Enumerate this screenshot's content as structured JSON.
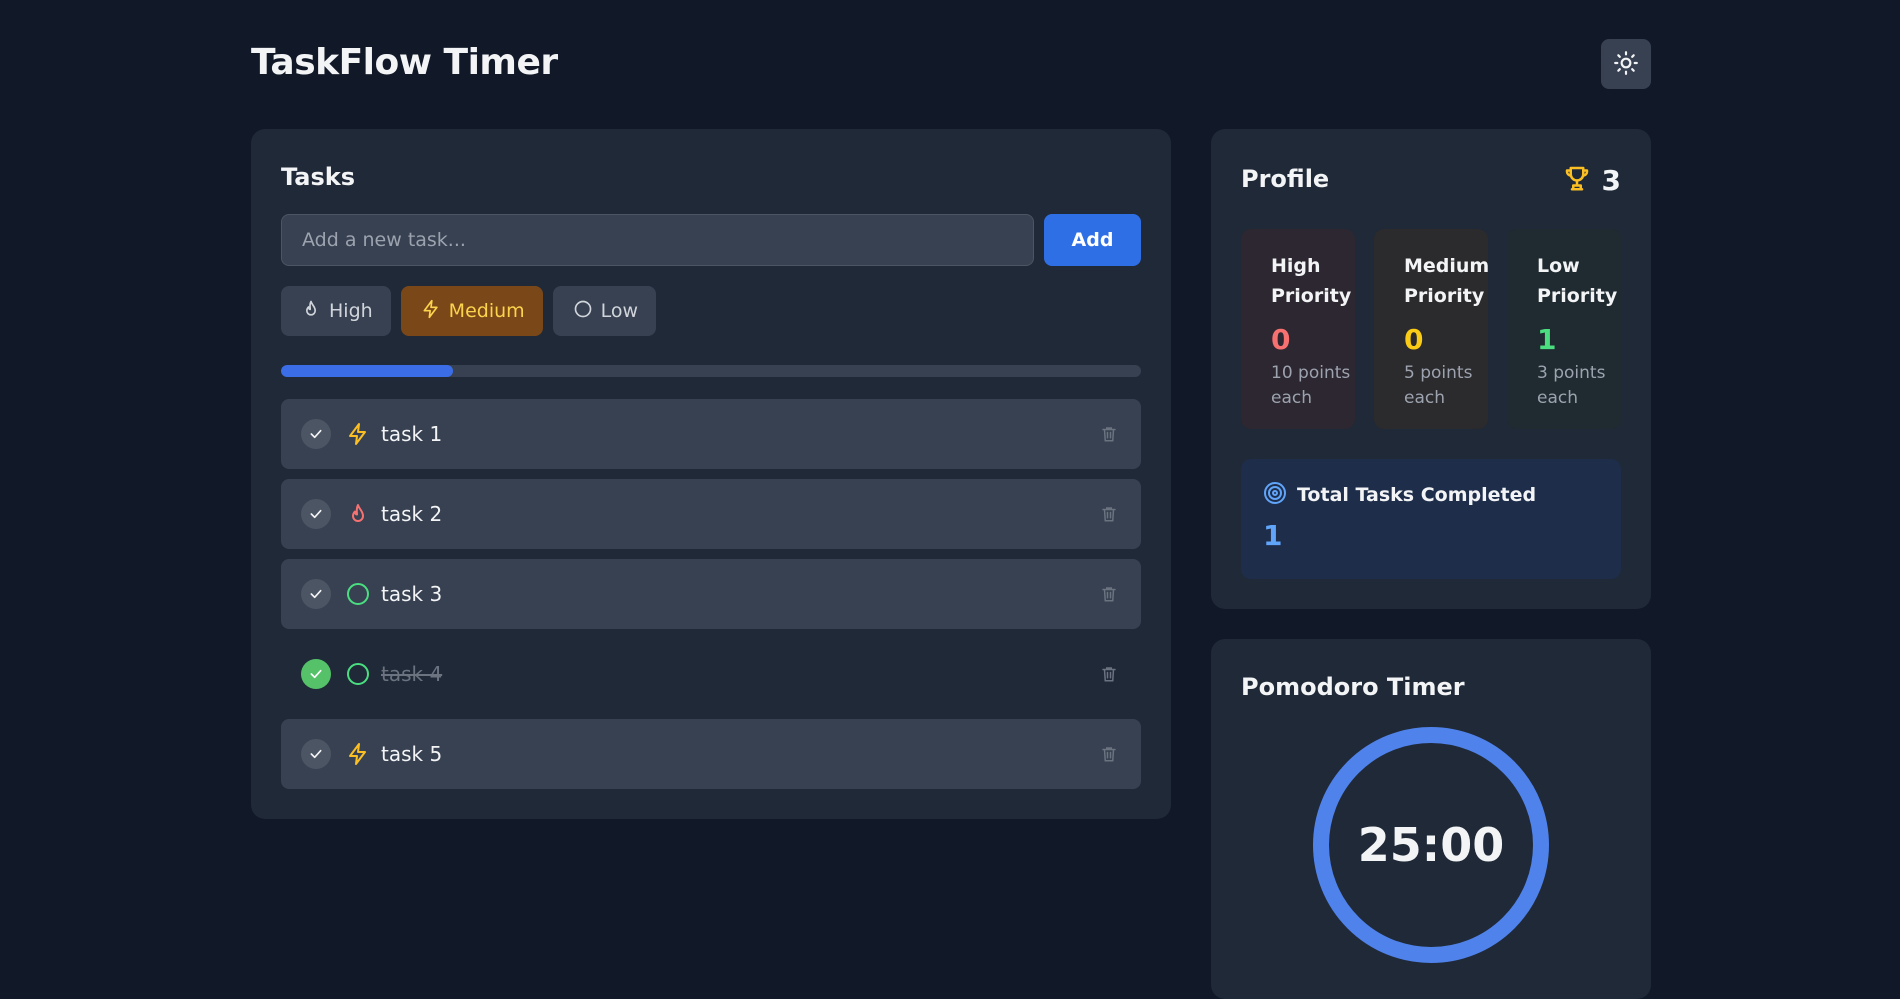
{
  "app": {
    "title": "TaskFlow Timer"
  },
  "theme_toggle": {
    "icon": "sun-icon"
  },
  "tasks": {
    "title": "Tasks",
    "input_placeholder": "Add a new task...",
    "add_label": "Add",
    "priorities": [
      {
        "label": "High",
        "icon": "flame-icon",
        "selected": false
      },
      {
        "label": "Medium",
        "icon": "lightning-icon",
        "selected": true
      },
      {
        "label": "Low",
        "icon": "circle-icon",
        "selected": false
      }
    ],
    "progress_fraction": 0.2,
    "items": [
      {
        "text": "task 1",
        "priority": "medium",
        "completed": false
      },
      {
        "text": "task 2",
        "priority": "high",
        "completed": false
      },
      {
        "text": "task 3",
        "priority": "low",
        "completed": false
      },
      {
        "text": "task 4",
        "priority": "low",
        "completed": true
      },
      {
        "text": "task 5",
        "priority": "medium",
        "completed": false
      }
    ]
  },
  "profile": {
    "title": "Profile",
    "points": "3",
    "stats": {
      "high": {
        "label_line1": "High",
        "label_line2": "Priority",
        "count": "0",
        "desc_line1": "10 points",
        "desc_line2": "each"
      },
      "medium": {
        "label_line1": "Medium",
        "label_line2": "Priority",
        "count": "0",
        "desc_line1": "5 points",
        "desc_line2": "each"
      },
      "low": {
        "label_line1": "Low",
        "label_line2": "Priority",
        "count": "1",
        "desc_line1": "3 points",
        "desc_line2": "each"
      }
    },
    "total": {
      "label": "Total Tasks Completed",
      "value": "1"
    }
  },
  "pomodoro": {
    "title": "Pomodoro Timer",
    "time": "25:00"
  },
  "colors": {
    "background": "#111827",
    "card": "#1f2937",
    "accent_blue": "#3b82f6",
    "high": "#f87171",
    "medium": "#facc15",
    "low": "#4ade80"
  }
}
